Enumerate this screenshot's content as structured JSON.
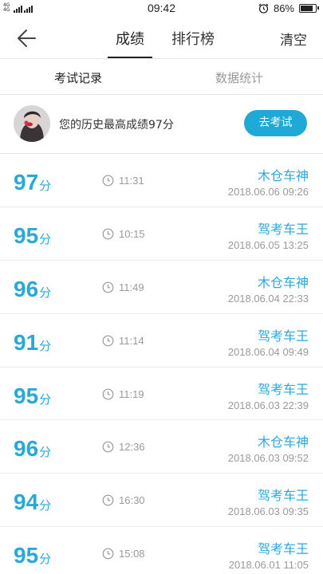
{
  "status_bar": {
    "network_label": "4G 4G",
    "time": "09:42",
    "battery_percent": "86%",
    "battery_level": 0.86,
    "icons": [
      "signal-icon",
      "alarm-icon",
      "battery-icon"
    ]
  },
  "nav": {
    "tabs": [
      {
        "label": "成绩",
        "active": true
      },
      {
        "label": "排行榜",
        "active": false
      }
    ],
    "clear_label": "清空",
    "back_icon": "back-arrow-icon"
  },
  "subtabs": [
    {
      "label": "考试记录",
      "active": true
    },
    {
      "label": "数据统计",
      "active": false
    }
  ],
  "best": {
    "text": "您的历史最高成绩97分",
    "button_label": "去考试"
  },
  "colors": {
    "accent": "#2aa8d8",
    "button": "#1fa9d7",
    "muted": "#9a9a9a"
  },
  "records": [
    {
      "score": "97",
      "unit": "分",
      "duration": "11:31",
      "name": "木仓车神",
      "date": "2018.06.06  09:26"
    },
    {
      "score": "95",
      "unit": "分",
      "duration": "10:15",
      "name": "驾考车王",
      "date": "2018.06.05  13:25"
    },
    {
      "score": "96",
      "unit": "分",
      "duration": "11:49",
      "name": "木仓车神",
      "date": "2018.06.04  22:33"
    },
    {
      "score": "91",
      "unit": "分",
      "duration": "11:14",
      "name": "驾考车王",
      "date": "2018.06.04  09:49"
    },
    {
      "score": "95",
      "unit": "分",
      "duration": "11:19",
      "name": "驾考车王",
      "date": "2018.06.03  22:39"
    },
    {
      "score": "96",
      "unit": "分",
      "duration": "12:36",
      "name": "木仓车神",
      "date": "2018.06.03  09:52"
    },
    {
      "score": "94",
      "unit": "分",
      "duration": "16:30",
      "name": "驾考车王",
      "date": "2018.06.03  09:35"
    },
    {
      "score": "95",
      "unit": "分",
      "duration": "15:08",
      "name": "驾考车王",
      "date": "2018.06.01  11:05"
    }
  ]
}
